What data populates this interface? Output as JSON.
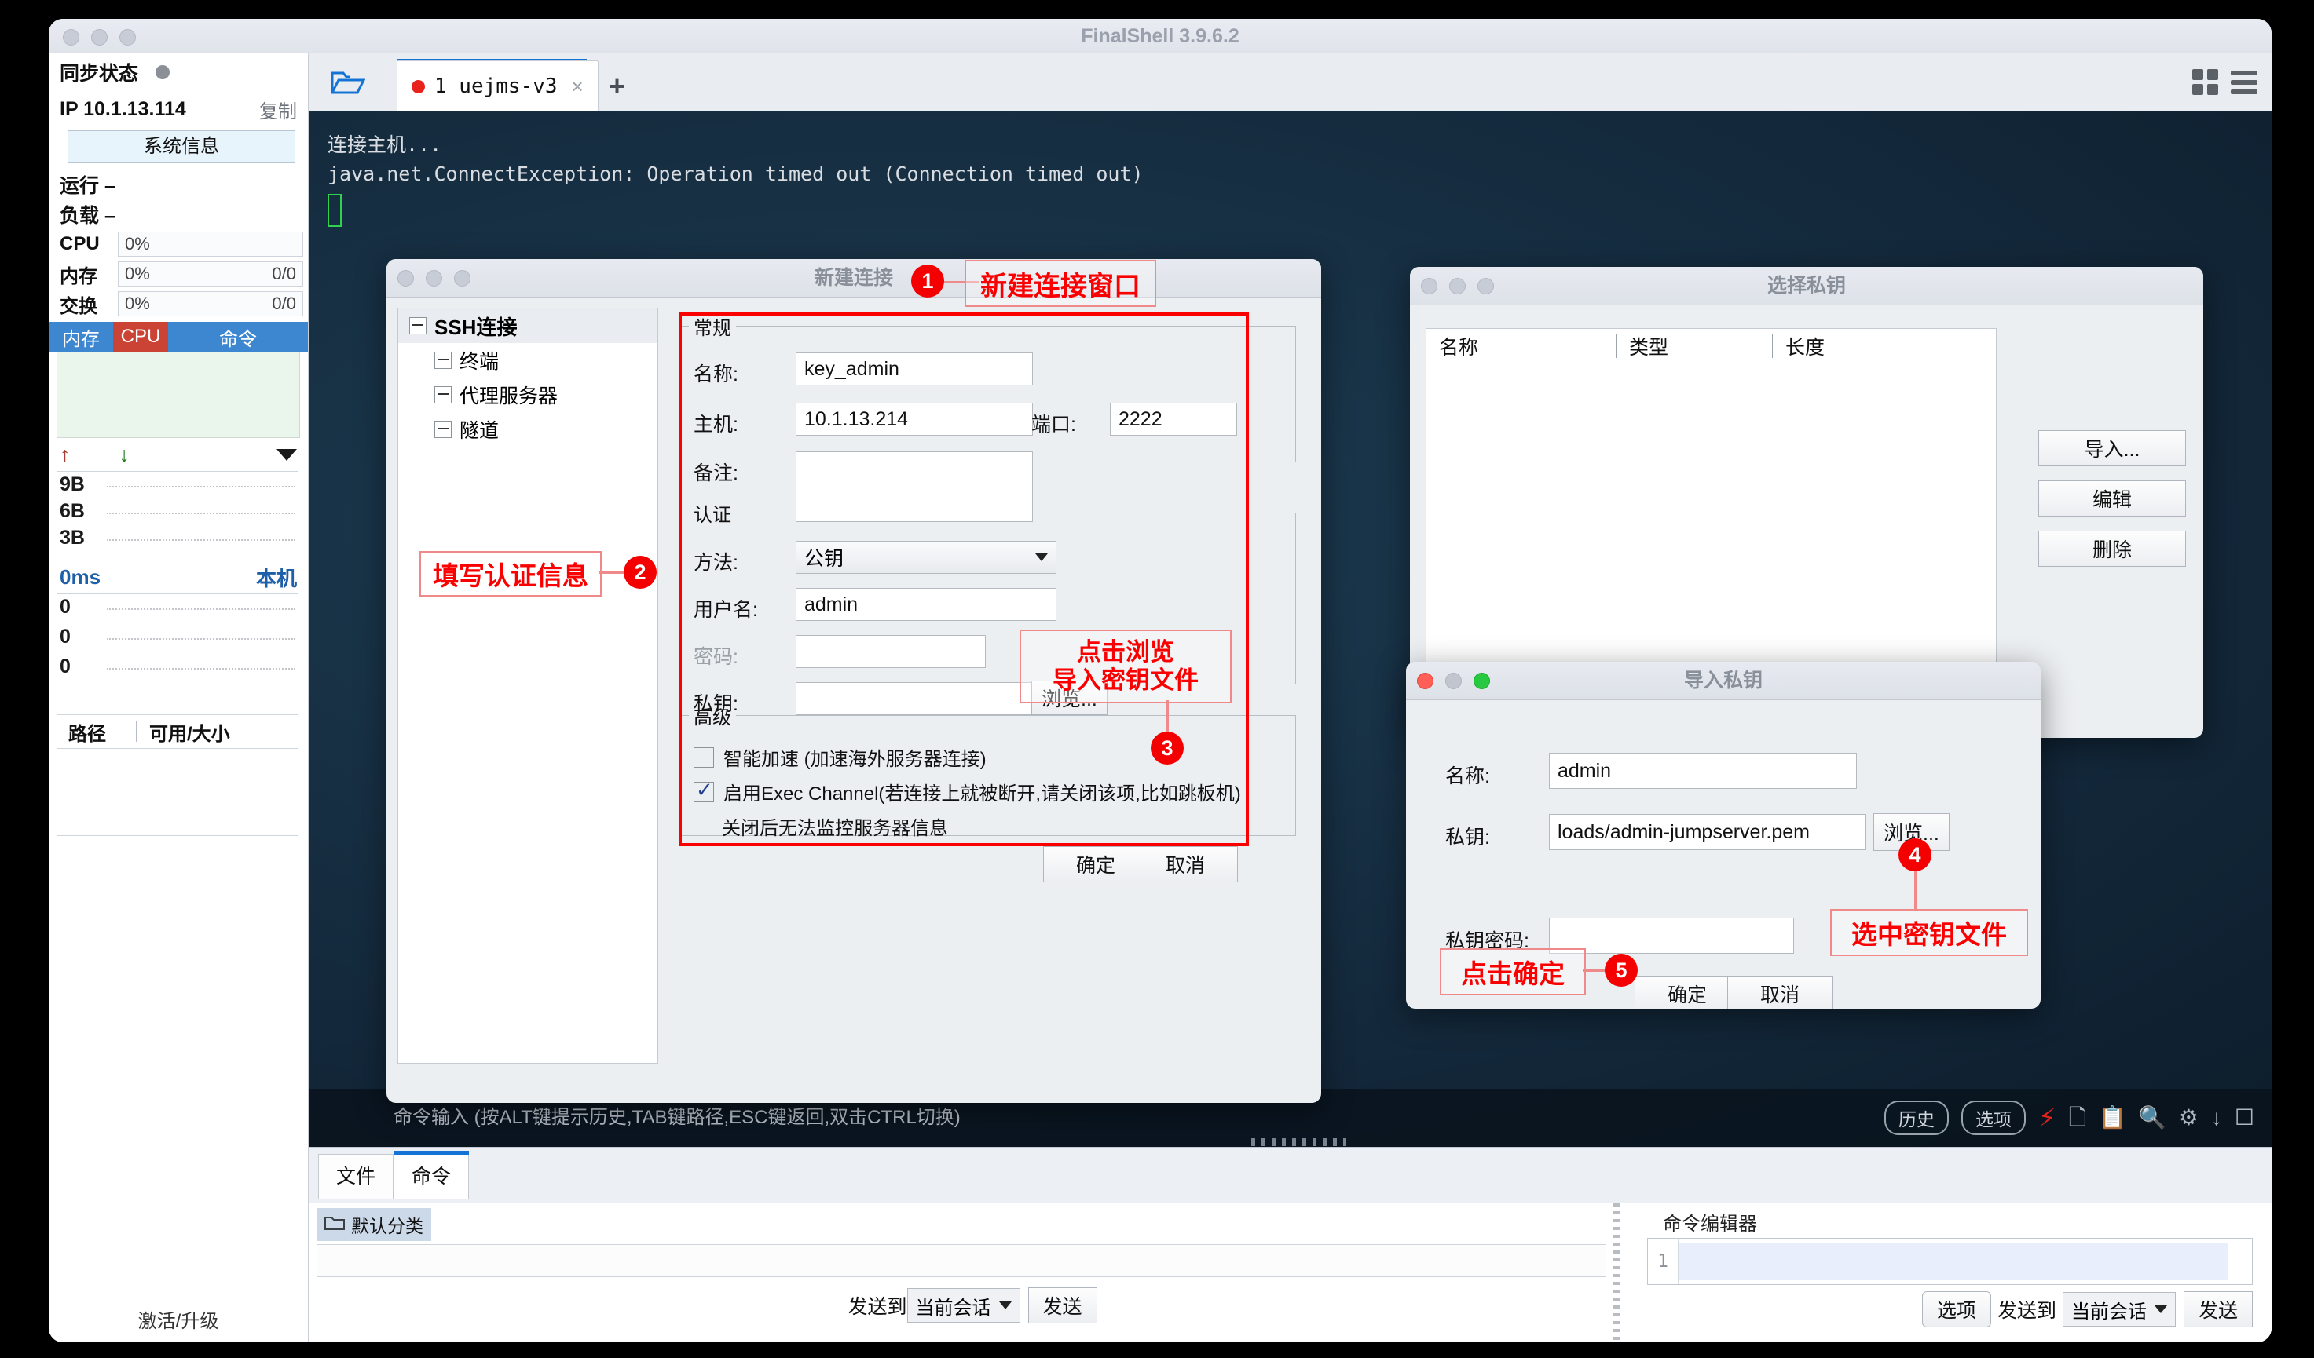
{
  "window": {
    "title": "FinalShell 3.9.6.2"
  },
  "sidebar": {
    "sync_label": "同步状态",
    "ip_label": "IP 10.1.13.114",
    "copy_label": "复制",
    "sysinfo_label": "系统信息",
    "uptime_label": "运行 –",
    "load_label": "负载 –",
    "metrics": [
      {
        "key": "CPU",
        "value": "0%",
        "extra": ""
      },
      {
        "key": "内存",
        "value": "0%",
        "extra": "0/0"
      },
      {
        "key": "交换",
        "value": "0%",
        "extra": "0/0"
      }
    ],
    "minitabs": [
      {
        "label": "内存",
        "color": "#3c87d0"
      },
      {
        "label": "CPU",
        "color": "#cb4335"
      },
      {
        "label": "命令",
        "color": "#3c87d0"
      }
    ],
    "net_labels": [
      "9B",
      "6B",
      "3B"
    ],
    "latency_label": "0ms",
    "host_label": "本机",
    "ping_labels": [
      "0",
      "0",
      "0"
    ],
    "disk_header": {
      "path": "路径",
      "size": "可用/大小"
    },
    "activate_label": "激活/升级"
  },
  "tabs": {
    "folder_icon": "folder-open-icon",
    "session": {
      "label": "1 uejms-v3",
      "close": "×"
    },
    "add_label": "+"
  },
  "terminal": {
    "lines": [
      "连接主机...",
      "java.net.ConnectException: Operation timed out (Connection timed out)"
    ],
    "command_hint": "命令输入 (按ALT键提示历史,TAB键路径,ESC键返回,双击CTRL切换)",
    "toolbar": {
      "history_label": "历史",
      "options_label": "选项",
      "icons": [
        "bolt-icon",
        "copy-icon",
        "paste-icon",
        "search-icon",
        "gear-icon",
        "download-icon",
        "window-icon"
      ]
    }
  },
  "bottom": {
    "tabs": [
      {
        "label": "文件",
        "active": false
      },
      {
        "label": "命令",
        "active": true
      }
    ],
    "category_label": "默认分类",
    "send_to_label": "发送到",
    "session_select": "当前会话",
    "send_label": "发送",
    "editor": {
      "title": "命令编辑器",
      "line_number": "1",
      "options_label": "选项",
      "send_to_label": "发送到",
      "session_select": "当前会话",
      "send_label": "发送"
    }
  },
  "new_connection_dialog": {
    "title": "新建连接",
    "tree": {
      "root": "SSH连接",
      "items": [
        "终端",
        "代理服务器",
        "隧道"
      ]
    },
    "general": {
      "legend": "常规",
      "name_label": "名称:",
      "name_value": "key_admin",
      "host_label": "主机:",
      "host_value": "10.1.13.214",
      "port_label": "端口:",
      "port_value": "2222",
      "note_label": "备注:",
      "note_value": ""
    },
    "auth": {
      "legend": "认证",
      "method_label": "方法:",
      "method_value": "公钥",
      "username_label": "用户名:",
      "username_value": "admin",
      "password_label": "密码:",
      "password_value": "",
      "privatekey_label": "私钥:",
      "privatekey_value": "",
      "browse_label": "浏览..."
    },
    "advanced": {
      "legend": "高级",
      "accel_label": "智能加速 (加速海外服务器连接)",
      "accel_checked": false,
      "exec_label": "启用Exec Channel(若连接上就被断开,请关闭该项,比如跳板机)",
      "exec_sub_label": "关闭后无法监控服务器信息",
      "exec_checked": true
    },
    "ok_label": "确定",
    "cancel_label": "取消"
  },
  "select_key_dialog": {
    "title": "选择私钥",
    "columns": [
      "名称",
      "类型",
      "长度"
    ],
    "rows": [],
    "buttons": [
      "导入...",
      "编辑",
      "删除"
    ]
  },
  "import_key_dialog": {
    "title": "导入私钥",
    "name_label": "名称:",
    "name_value": "admin",
    "key_label": "私钥:",
    "key_value": "loads/admin-jumpserver.pem",
    "browse_label": "浏览...",
    "passphrase_label": "私钥密码:",
    "passphrase_value": "",
    "ok_label": "确定",
    "cancel_label": "取消"
  },
  "annotations": [
    {
      "id": "1",
      "text": "新建连接窗口"
    },
    {
      "id": "2",
      "text": "填写认证信息"
    },
    {
      "id": "3",
      "text": "点击浏览\n导入密钥文件"
    },
    {
      "id": "4",
      "text": "选中密钥文件"
    },
    {
      "id": "5",
      "text": "点击确定"
    }
  ],
  "annotation_lines": {
    "a3_line1": "点击浏览",
    "a3_line2": "导入密钥文件"
  },
  "colors": {
    "accent": "#1573d6",
    "annotation": "#fb0000",
    "badge": "#f50000",
    "cpu_tab": "#cb4335",
    "mem_tab": "#3c87d0"
  }
}
